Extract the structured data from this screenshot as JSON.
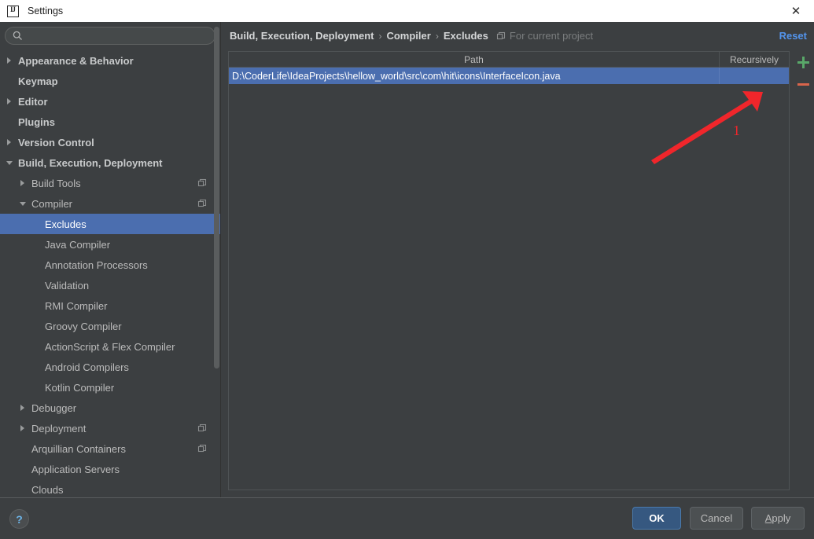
{
  "window": {
    "title": "Settings",
    "app_icon": "intellij-idea-icon",
    "close_icon": "close-icon"
  },
  "search": {
    "value": "",
    "placeholder": "",
    "icon": "search-icon"
  },
  "sidebar": {
    "scope_icon": "project-scope-icon",
    "items": [
      {
        "label": "Appearance & Behavior",
        "indent": 0,
        "arrow": "right",
        "bold": true,
        "scope": false,
        "selected": false
      },
      {
        "label": "Keymap",
        "indent": 0,
        "arrow": "none",
        "bold": true,
        "scope": false,
        "selected": false
      },
      {
        "label": "Editor",
        "indent": 0,
        "arrow": "right",
        "bold": true,
        "scope": false,
        "selected": false
      },
      {
        "label": "Plugins",
        "indent": 0,
        "arrow": "none",
        "bold": true,
        "scope": false,
        "selected": false
      },
      {
        "label": "Version Control",
        "indent": 0,
        "arrow": "right",
        "bold": true,
        "scope": false,
        "selected": false
      },
      {
        "label": "Build, Execution, Deployment",
        "indent": 0,
        "arrow": "down",
        "bold": true,
        "scope": false,
        "selected": false
      },
      {
        "label": "Build Tools",
        "indent": 1,
        "arrow": "right",
        "bold": false,
        "scope": true,
        "selected": false
      },
      {
        "label": "Compiler",
        "indent": 1,
        "arrow": "down",
        "bold": false,
        "scope": true,
        "selected": false
      },
      {
        "label": "Excludes",
        "indent": 2,
        "arrow": "none",
        "bold": false,
        "scope": false,
        "selected": true
      },
      {
        "label": "Java Compiler",
        "indent": 2,
        "arrow": "none",
        "bold": false,
        "scope": false,
        "selected": false
      },
      {
        "label": "Annotation Processors",
        "indent": 2,
        "arrow": "none",
        "bold": false,
        "scope": false,
        "selected": false
      },
      {
        "label": "Validation",
        "indent": 2,
        "arrow": "none",
        "bold": false,
        "scope": false,
        "selected": false
      },
      {
        "label": "RMI Compiler",
        "indent": 2,
        "arrow": "none",
        "bold": false,
        "scope": false,
        "selected": false
      },
      {
        "label": "Groovy Compiler",
        "indent": 2,
        "arrow": "none",
        "bold": false,
        "scope": false,
        "selected": false
      },
      {
        "label": "ActionScript & Flex Compiler",
        "indent": 2,
        "arrow": "none",
        "bold": false,
        "scope": false,
        "selected": false
      },
      {
        "label": "Android Compilers",
        "indent": 2,
        "arrow": "none",
        "bold": false,
        "scope": false,
        "selected": false
      },
      {
        "label": "Kotlin Compiler",
        "indent": 2,
        "arrow": "none",
        "bold": false,
        "scope": false,
        "selected": false
      },
      {
        "label": "Debugger",
        "indent": 1,
        "arrow": "right",
        "bold": false,
        "scope": false,
        "selected": false
      },
      {
        "label": "Deployment",
        "indent": 1,
        "arrow": "right",
        "bold": false,
        "scope": true,
        "selected": false
      },
      {
        "label": "Arquillian Containers",
        "indent": 1,
        "arrow": "none",
        "bold": false,
        "scope": true,
        "selected": false
      },
      {
        "label": "Application Servers",
        "indent": 1,
        "arrow": "none",
        "bold": false,
        "scope": false,
        "selected": false
      },
      {
        "label": "Clouds",
        "indent": 1,
        "arrow": "none",
        "bold": false,
        "scope": false,
        "selected": false
      }
    ]
  },
  "content": {
    "breadcrumb": [
      "Build, Execution, Deployment",
      "Compiler",
      "Excludes"
    ],
    "breadcrumb_separator": "›",
    "scope_icon": "project-scope-icon",
    "scope_note": "For current project",
    "reset_label": "Reset",
    "table": {
      "columns": [
        "Path",
        "Recursively"
      ],
      "rows": [
        {
          "path": "D:\\CoderLife\\IdeaProjects\\hellow_world\\src\\com\\hit\\icons\\InterfaceIcon.java",
          "recursively": "",
          "selected": true
        }
      ],
      "add_icon": "plus-icon",
      "remove_icon": "minus-icon"
    }
  },
  "annotation": {
    "number": "1",
    "arrow_color": "#f0262b"
  },
  "footer": {
    "help_label": "?",
    "ok_label": "OK",
    "cancel_label": "Cancel",
    "apply_mnemonic": "A",
    "apply_rest": "pply"
  },
  "colors": {
    "background": "#3c3f41",
    "selection_blue": "#4b6eaf",
    "link_blue": "#5394ec",
    "default_button": "#365880",
    "add_green": "#59a869",
    "remove_red": "#d9654b",
    "annotation_red": "#f0262b"
  }
}
